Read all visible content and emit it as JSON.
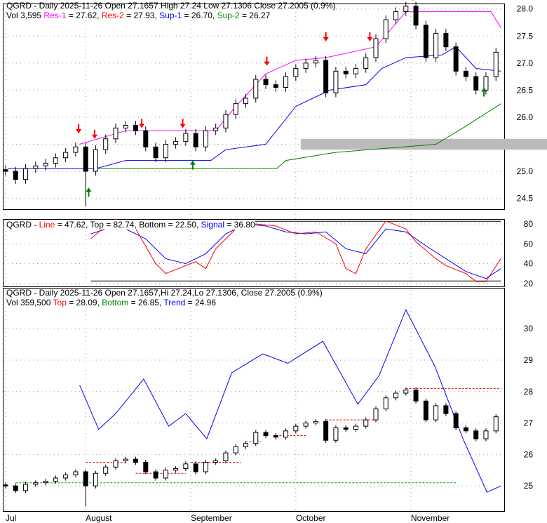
{
  "chart_data": {
    "type": "candlestick",
    "symbol": "QGRD",
    "panel1": {
      "line1": [
        "QGRD - Daily 2025-11-26 Open 27.1657  High 27.24  Low 27.1306  Close 27.2005 (0.9%)"
      ],
      "vol": "Vol 3,595",
      "res1": "Res-1",
      "res1_val": " = 27.62, ",
      "res2": "Res-2",
      "res2_val": " = 27.93, ",
      "sup1": "Sup-1",
      "sup1_val": " = 26.70, ",
      "sup2": "Sup-2",
      "sup2_val": " = 26.27",
      "yticks": [
        28.0,
        27.5,
        27.0,
        26.5,
        26.0,
        25.5,
        25.0,
        24.5
      ],
      "ylim": [
        24.3,
        28.1
      ],
      "res1_line": [
        [
          7.4,
          25.5
        ],
        [
          12,
          25.75
        ],
        [
          21,
          25.75
        ],
        [
          23,
          26.2
        ],
        [
          26,
          26.8
        ],
        [
          29,
          27.05
        ],
        [
          32,
          27.1
        ],
        [
          37,
          27.3
        ],
        [
          40,
          27.95
        ],
        [
          48.5,
          27.95
        ],
        [
          49.5,
          27.65
        ]
      ],
      "sup1_line": [
        [
          0.2,
          25.05
        ],
        [
          9,
          25.05
        ],
        [
          12,
          25.2
        ],
        [
          20.5,
          25.2
        ],
        [
          22,
          25.4
        ],
        [
          26,
          25.5
        ],
        [
          29,
          26.2
        ],
        [
          32.4,
          26.5
        ],
        [
          36,
          26.6
        ],
        [
          37.6,
          26.9
        ],
        [
          40,
          27.1
        ],
        [
          43.6,
          27.15
        ],
        [
          45,
          27.3
        ],
        [
          47,
          26.9
        ],
        [
          49.5,
          26.85
        ]
      ],
      "sup2_line": [
        [
          9,
          25.05
        ],
        [
          27.1,
          25.05
        ],
        [
          28,
          25.2
        ],
        [
          33,
          25.35
        ],
        [
          43,
          25.5
        ],
        [
          45.7,
          25.8
        ],
        [
          49.5,
          26.25
        ]
      ],
      "band": 25.5
    },
    "panel2": {
      "title": "QGRD - ",
      "line": "Line",
      "line_val": " = 47.62, Top = 82.74, Bottom = 22.50, ",
      "signal": "Signal",
      "signal_val": " = 36.80",
      "yticks": [
        80,
        60,
        40,
        20
      ],
      "ylim": [
        17,
        85
      ],
      "line_series": [
        [
          8.5,
          65
        ],
        [
          10,
          78
        ],
        [
          11,
          85
        ],
        [
          13,
          75
        ],
        [
          15,
          40
        ],
        [
          16,
          30
        ],
        [
          18,
          38
        ],
        [
          19,
          42
        ],
        [
          20,
          35
        ],
        [
          21,
          55
        ],
        [
          23,
          75
        ],
        [
          25,
          80
        ],
        [
          27,
          78
        ],
        [
          29,
          70
        ],
        [
          31,
          72
        ],
        [
          33,
          60
        ],
        [
          34,
          35
        ],
        [
          35,
          30
        ],
        [
          36,
          55
        ],
        [
          38,
          83
        ],
        [
          40,
          75
        ],
        [
          41,
          62
        ],
        [
          43,
          45
        ],
        [
          44,
          38
        ],
        [
          46,
          30
        ],
        [
          47,
          22
        ],
        [
          48,
          22
        ],
        [
          49.5,
          45
        ]
      ],
      "signal_series": [
        [
          8.5,
          70
        ],
        [
          11,
          78
        ],
        [
          12,
          75
        ],
        [
          14,
          65
        ],
        [
          16,
          45
        ],
        [
          18,
          40
        ],
        [
          20,
          50
        ],
        [
          22,
          70
        ],
        [
          24,
          80
        ],
        [
          26,
          78
        ],
        [
          28,
          72
        ],
        [
          30,
          70
        ],
        [
          32,
          72
        ],
        [
          34,
          55
        ],
        [
          36,
          50
        ],
        [
          38,
          75
        ],
        [
          40,
          72
        ],
        [
          42,
          58
        ],
        [
          44,
          45
        ],
        [
          46,
          32
        ],
        [
          48,
          25
        ],
        [
          49.5,
          35
        ]
      ],
      "top": 82.74,
      "bottom": 22.5
    },
    "panel3": {
      "line1": "QGRD - Daily 2025-11-26 Open 27.1657,Hi 27.24,Lo 27.1306, Close 27.2005 (0.9%)",
      "vol": "Vol 359,500 ",
      "top": "Top",
      "top_val": " = 28.09, ",
      "bottom": "Bottom",
      "bottom_val": " = 26.85, ",
      "trend": "Trend",
      "trend_val": " = 24.96",
      "yticks": [
        30,
        29,
        28,
        27,
        26,
        25
      ],
      "ylim": [
        24.2,
        31.3
      ],
      "trend_series": [
        [
          7.4,
          28.2
        ],
        [
          9.3,
          26.8
        ],
        [
          11,
          27.3
        ],
        [
          13.8,
          28.4
        ],
        [
          16.3,
          26.9
        ],
        [
          18,
          27.3
        ],
        [
          20.1,
          26.5
        ],
        [
          22.6,
          28.6
        ],
        [
          25.7,
          29.2
        ],
        [
          28.2,
          28.9
        ],
        [
          31.7,
          29.6
        ],
        [
          35.2,
          27.6
        ],
        [
          37.3,
          28.5
        ],
        [
          40,
          30.6
        ],
        [
          42.9,
          28.8
        ],
        [
          45.7,
          26.5
        ],
        [
          48.1,
          24.8
        ],
        [
          49.5,
          25.0
        ]
      ]
    },
    "xlabels": [
      {
        "label": "Jul",
        "i": 0
      },
      {
        "label": "August",
        "i": 8
      },
      {
        "label": "September",
        "i": 18.5
      },
      {
        "label": "October",
        "i": 29
      },
      {
        "label": "November",
        "i": 40.5
      }
    ],
    "closes": [
      25.0,
      24.85,
      25.05,
      25.1,
      25.15,
      25.25,
      25.35,
      25.45,
      25.0,
      25.4,
      25.6,
      25.8,
      25.85,
      25.75,
      25.45,
      25.25,
      25.5,
      25.55,
      25.7,
      25.45,
      25.75,
      25.8,
      26.05,
      26.25,
      26.35,
      26.7,
      26.6,
      26.55,
      26.75,
      26.9,
      27.0,
      27.05,
      26.45,
      26.85,
      26.8,
      26.9,
      27.1,
      27.45,
      27.8,
      27.95,
      28.05,
      27.7,
      27.1,
      27.55,
      27.3,
      26.85,
      26.75,
      26.5,
      26.75,
      27.2
    ],
    "colors": {
      "up_arrow": "#008000",
      "down_arrow": "#ff0000",
      "res1": "#ff00ff",
      "res2": "#ff0000",
      "sup1": "#0000ff",
      "sup2": "#008000"
    }
  }
}
